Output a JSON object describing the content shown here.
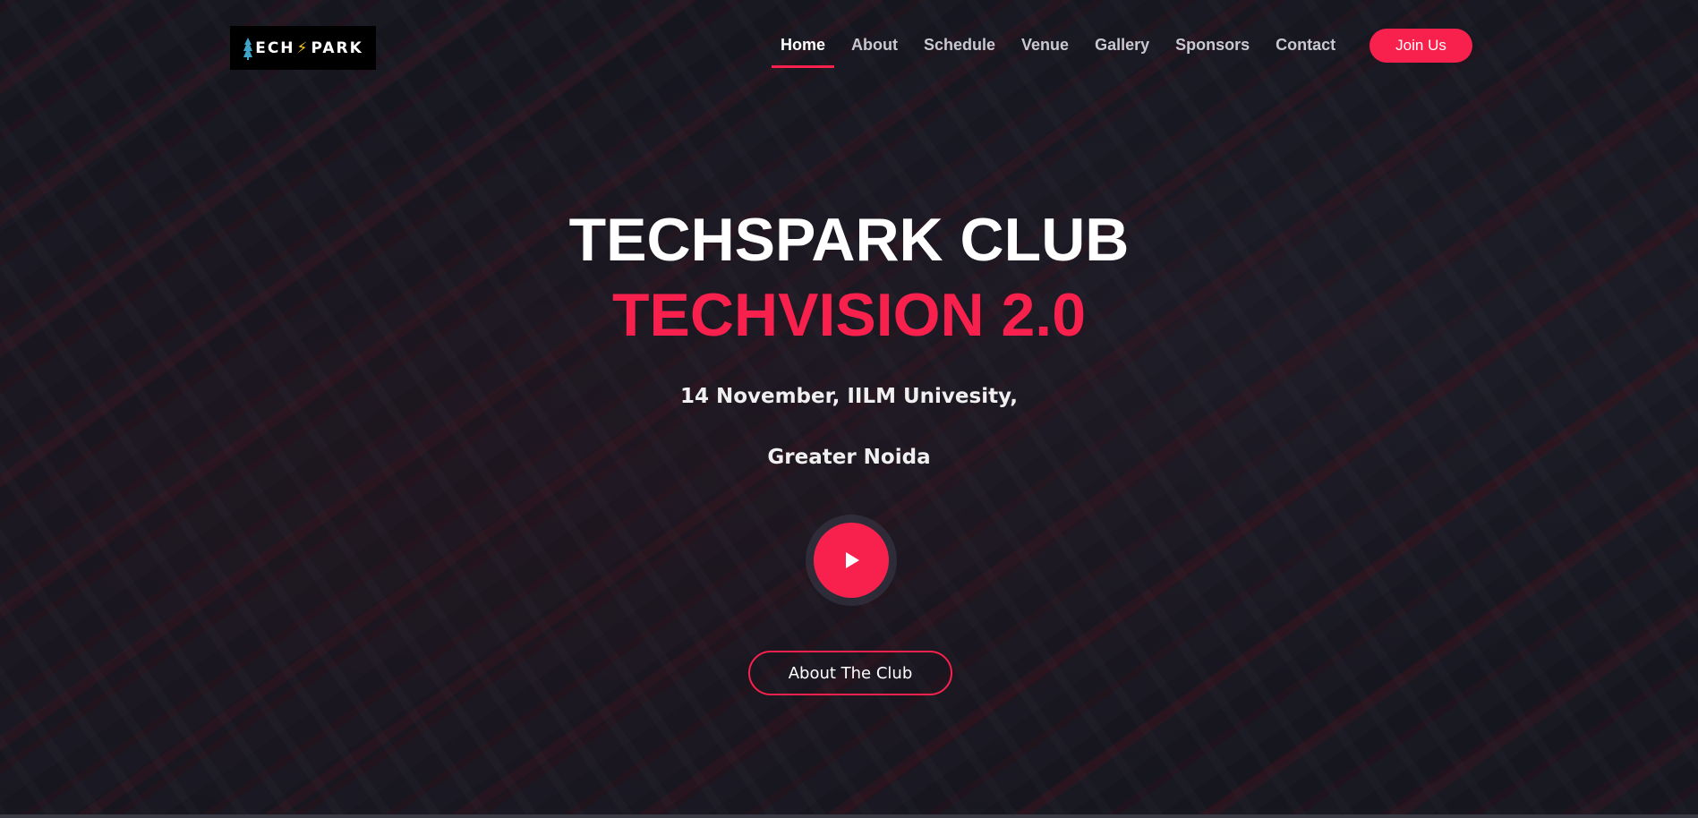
{
  "header": {
    "logo": {
      "text_left": "ECH",
      "text_right": "PARK",
      "icon_tree": "tree-icon",
      "icon_bolt": "lightning-bolt-icon"
    },
    "nav": [
      {
        "label": "Home",
        "active": true
      },
      {
        "label": "About",
        "active": false
      },
      {
        "label": "Schedule",
        "active": false
      },
      {
        "label": "Venue",
        "active": false
      },
      {
        "label": "Gallery",
        "active": false
      },
      {
        "label": "Sponsors",
        "active": false
      },
      {
        "label": "Contact",
        "active": false
      }
    ],
    "cta_label": "Join Us"
  },
  "hero": {
    "title_line1": "TECHSPARK CLUB",
    "title_line2": "TECHVISION 2.0",
    "date_line": "14 November, IILM Univesity,",
    "place_line": "Greater Noida",
    "play_icon": "play-icon",
    "about_button_label": "About The Club"
  },
  "colors": {
    "accent": "#f8214d",
    "text": "#ffffff",
    "overlay": "#0e0e18"
  }
}
